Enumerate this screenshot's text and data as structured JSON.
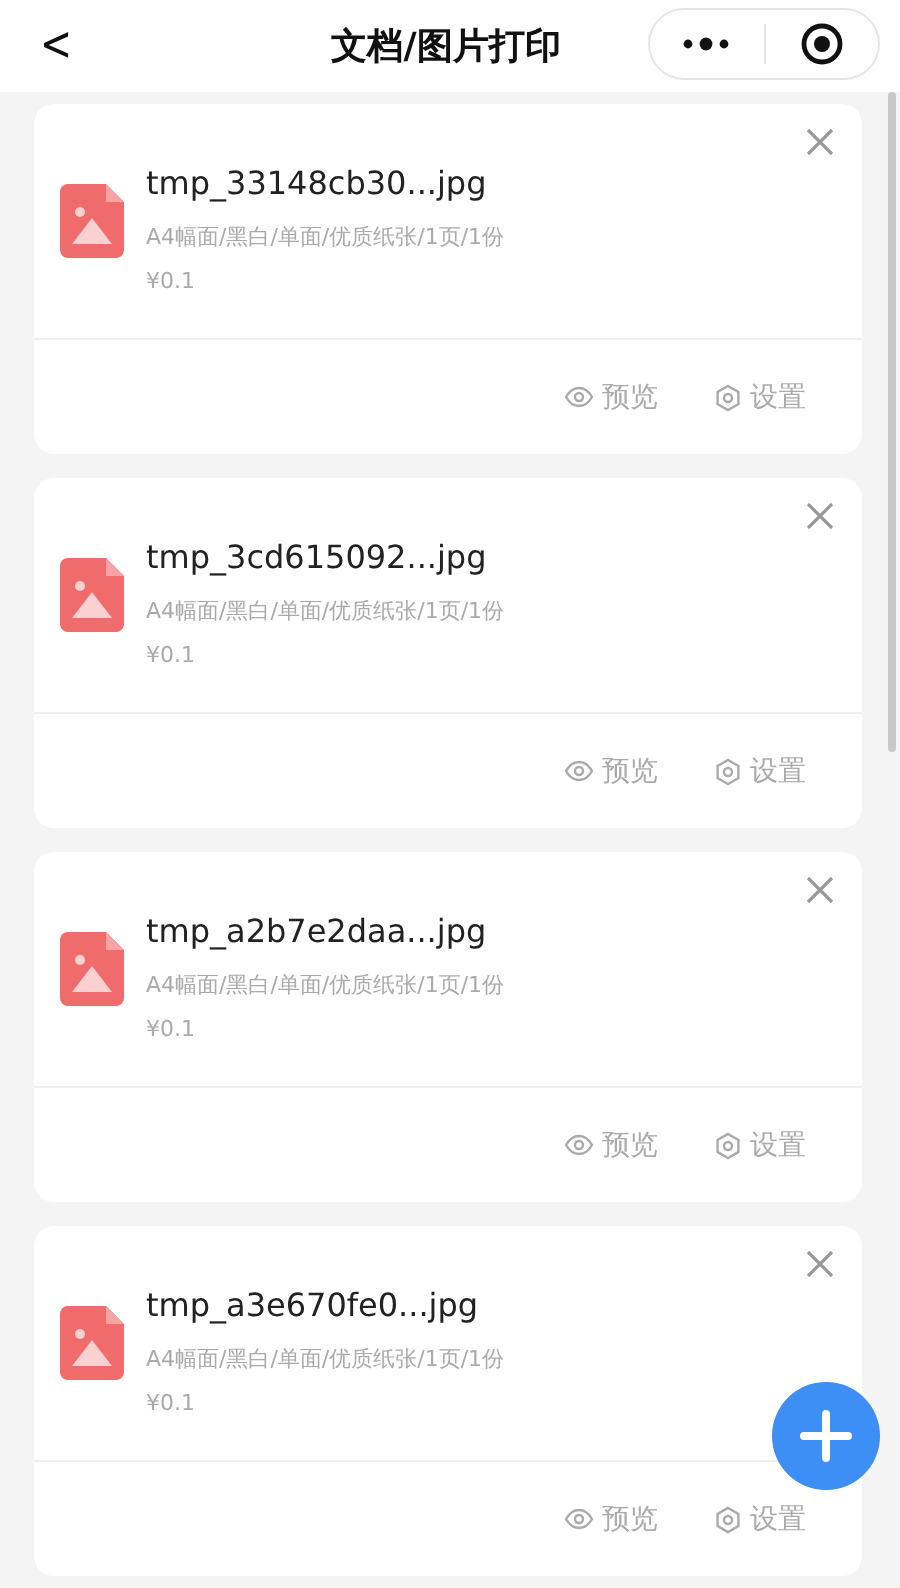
{
  "nav": {
    "back": "<",
    "title": "文档/图片打印"
  },
  "files": [
    {
      "name": "tmp_33148cb30...jpg",
      "meta": "A4幅面/黑白/单面/优质纸张/1页/1份",
      "price": "¥0.1",
      "preview": "预览",
      "settings": "设置"
    },
    {
      "name": "tmp_3cd615092...jpg",
      "meta": "A4幅面/黑白/单面/优质纸张/1页/1份",
      "price": "¥0.1",
      "preview": "预览",
      "settings": "设置"
    },
    {
      "name": "tmp_a2b7e2daa...jpg",
      "meta": "A4幅面/黑白/单面/优质纸张/1页/1份",
      "price": "¥0.1",
      "preview": "预览",
      "settings": "设置"
    },
    {
      "name": "tmp_a3e670fe0...jpg",
      "meta": "A4幅面/黑白/单面/优质纸张/1页/1份",
      "price": "¥0.1",
      "preview": "预览",
      "settings": "设置"
    }
  ]
}
